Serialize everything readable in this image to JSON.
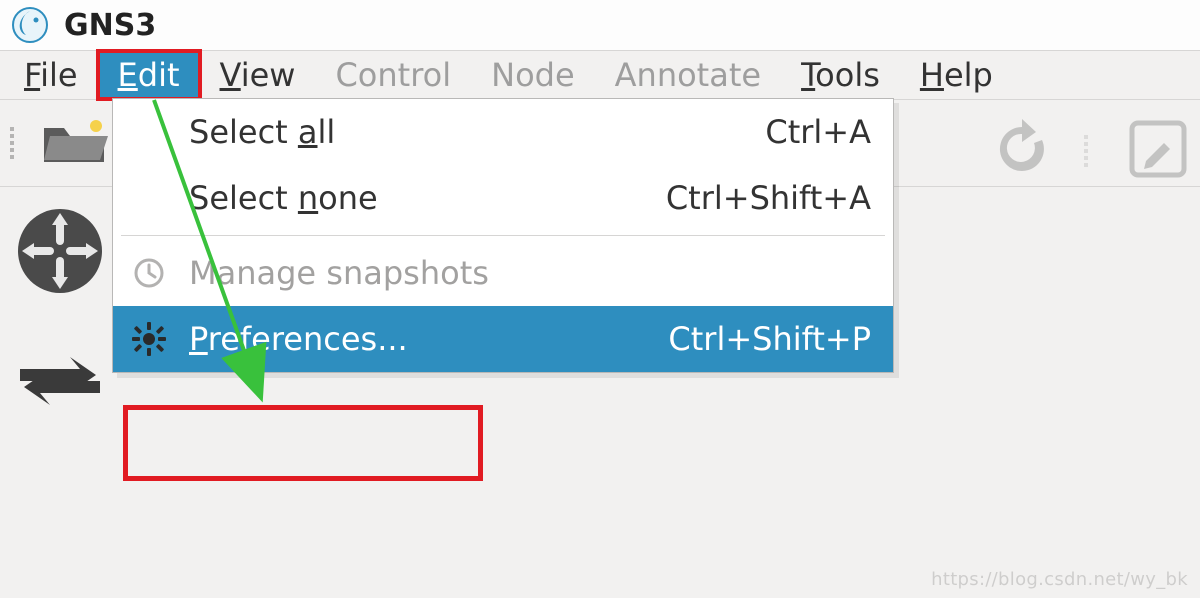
{
  "titlebar": {
    "app_name": "GNS3"
  },
  "menubar": {
    "file": {
      "label": "File",
      "mn": "F",
      "enabled": true
    },
    "edit": {
      "label": "Edit",
      "mn": "E",
      "enabled": true,
      "active": true
    },
    "view": {
      "label": "View",
      "mn": "V",
      "enabled": true
    },
    "control": {
      "label": "Control",
      "mn": "",
      "enabled": false
    },
    "node": {
      "label": "Node",
      "mn": "",
      "enabled": false
    },
    "annotate": {
      "label": "Annotate",
      "mn": "",
      "enabled": false
    },
    "tools": {
      "label": "Tools",
      "mn": "T",
      "enabled": true
    },
    "help": {
      "label": "Help",
      "mn": "H",
      "enabled": true
    }
  },
  "dropdown": {
    "select_all": {
      "label_pre": "Select ",
      "mn": "a",
      "label_post": "ll",
      "shortcut": "Ctrl+A",
      "enabled": true
    },
    "select_none": {
      "label_pre": "Select ",
      "mn": "n",
      "label_post": "one",
      "shortcut": "Ctrl+Shift+A",
      "enabled": true
    },
    "manage_snapshots": {
      "label": "Manage snapshots",
      "shortcut": "",
      "enabled": false
    },
    "preferences": {
      "label_pre": "",
      "mn": "P",
      "label_post": "references...",
      "shortcut": "Ctrl+Shift+P",
      "enabled": true,
      "highlighted": true
    }
  },
  "icons": {
    "app": "gns3-logo",
    "open": "folder-open-icon",
    "refresh": "refresh-icon",
    "edit_note": "edit-icon",
    "router": "router-icon",
    "link": "link-icon",
    "clock": "clock-icon",
    "gear": "gear-icon"
  },
  "watermark": "https://blog.csdn.net/wy_bk"
}
